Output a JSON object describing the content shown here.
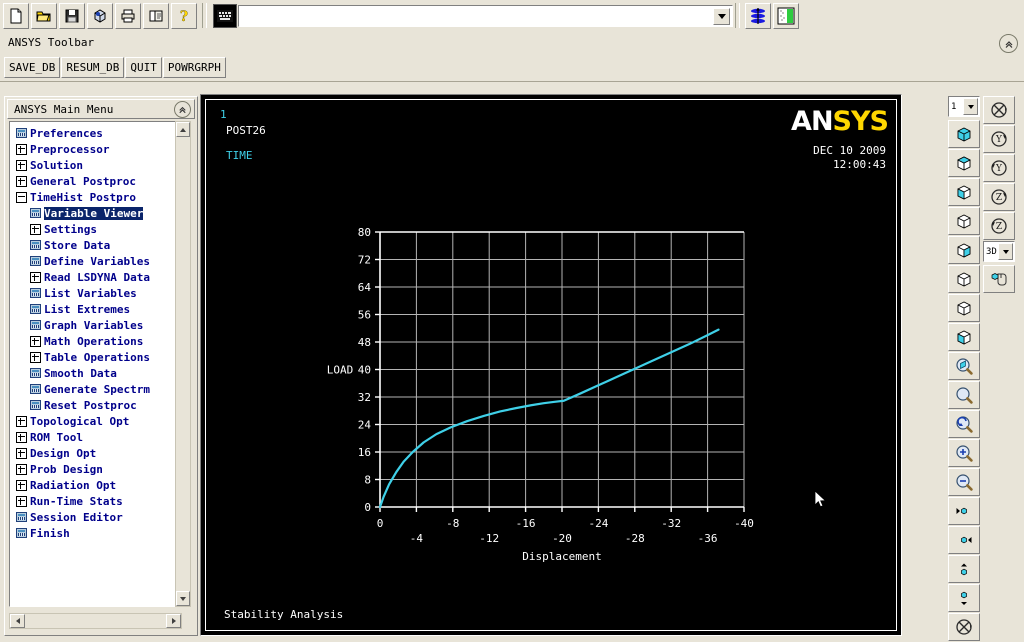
{
  "toolbar_top": {
    "buttons": [
      {
        "name": "new-file-icon",
        "label": "New"
      },
      {
        "name": "open-folder-icon",
        "label": "Open"
      },
      {
        "name": "save-disk-icon",
        "label": "Save"
      },
      {
        "name": "cube-report-icon",
        "label": "Report"
      },
      {
        "name": "printer-icon",
        "label": "Print"
      },
      {
        "name": "pages-icon",
        "label": "Pages"
      },
      {
        "name": "help-question-icon",
        "label": "Help"
      }
    ],
    "right_buttons": [
      {
        "name": "pan-zoom-rotate-icon",
        "label": "Pan-Zoom-Rotate"
      },
      {
        "name": "contour-plot-icon",
        "label": "Contour Plot"
      }
    ],
    "command_input": {
      "value": "",
      "placeholder": ""
    }
  },
  "ansys_toolbar": {
    "title": "ANSYS Toolbar",
    "collapse_icon": "chevron-up-circle-icon",
    "buttons": [
      "SAVE_DB",
      "RESUM_DB",
      "QUIT",
      "POWRGRPH"
    ]
  },
  "sidebar": {
    "title": "ANSYS Main Menu",
    "collapse_icon": "chevron-up-circle-icon",
    "items": [
      {
        "label": "Preferences",
        "indent": 0,
        "marker": "sheet",
        "selected": false
      },
      {
        "label": "Preprocessor",
        "indent": 0,
        "marker": "plus",
        "selected": false
      },
      {
        "label": "Solution",
        "indent": 0,
        "marker": "plus",
        "selected": false
      },
      {
        "label": "General Postproc",
        "indent": 0,
        "marker": "plus",
        "selected": false
      },
      {
        "label": "TimeHist Postpro",
        "indent": 0,
        "marker": "minus",
        "selected": false
      },
      {
        "label": "Variable Viewer",
        "indent": 1,
        "marker": "sheet",
        "selected": true
      },
      {
        "label": "Settings",
        "indent": 1,
        "marker": "plus",
        "selected": false
      },
      {
        "label": "Store Data",
        "indent": 1,
        "marker": "sheet",
        "selected": false
      },
      {
        "label": "Define Variables",
        "indent": 1,
        "marker": "sheet",
        "selected": false
      },
      {
        "label": "Read LSDYNA Data",
        "indent": 1,
        "marker": "plus",
        "selected": false
      },
      {
        "label": "List Variables",
        "indent": 1,
        "marker": "sheet",
        "selected": false
      },
      {
        "label": "List Extremes",
        "indent": 1,
        "marker": "sheet",
        "selected": false
      },
      {
        "label": "Graph Variables",
        "indent": 1,
        "marker": "sheet",
        "selected": false
      },
      {
        "label": "Math Operations",
        "indent": 1,
        "marker": "plus",
        "selected": false
      },
      {
        "label": "Table Operations",
        "indent": 1,
        "marker": "plus",
        "selected": false
      },
      {
        "label": "Smooth Data",
        "indent": 1,
        "marker": "sheet",
        "selected": false
      },
      {
        "label": "Generate Spectrm",
        "indent": 1,
        "marker": "sheet",
        "selected": false
      },
      {
        "label": "Reset Postproc",
        "indent": 1,
        "marker": "sheet",
        "selected": false
      },
      {
        "label": "Topological Opt",
        "indent": 0,
        "marker": "plus",
        "selected": false
      },
      {
        "label": "ROM Tool",
        "indent": 0,
        "marker": "plus",
        "selected": false
      },
      {
        "label": "Design Opt",
        "indent": 0,
        "marker": "plus",
        "selected": false
      },
      {
        "label": "Prob Design",
        "indent": 0,
        "marker": "plus",
        "selected": false
      },
      {
        "label": "Radiation Opt",
        "indent": 0,
        "marker": "plus",
        "selected": false
      },
      {
        "label": "Run-Time Stats",
        "indent": 0,
        "marker": "plus",
        "selected": false
      },
      {
        "label": "Session Editor",
        "indent": 0,
        "marker": "sheet",
        "selected": false
      },
      {
        "label": "Finish",
        "indent": 0,
        "marker": "sheet",
        "selected": false
      }
    ]
  },
  "graphics": {
    "window_number": "1",
    "post_processor": "POST26",
    "variable": "TIME",
    "logo_white": "AN",
    "logo_yellow": "SYS",
    "date": "DEC 10 2009",
    "time": "12:00:43",
    "caption": "Stability Analysis",
    "colors": {
      "background": "#000000",
      "curve": "#3fd0e8",
      "grid": "#b4b4b4",
      "axis": "#ffffff",
      "logo_accent": "#ffd700"
    }
  },
  "chart_data": {
    "type": "line",
    "title": "Stability Analysis",
    "subtitle": "POST26",
    "xlabel": "Displacement",
    "ylabel": "LOAD",
    "xlim": [
      0,
      -40
    ],
    "ylim": [
      0,
      80
    ],
    "xticks": [
      0,
      -4,
      -8,
      -12,
      -16,
      -20,
      -24,
      -28,
      -32,
      -36,
      -40
    ],
    "yticks": [
      0,
      8,
      16,
      24,
      32,
      40,
      48,
      56,
      64,
      72,
      80
    ],
    "grid": true,
    "legend": false,
    "series": [
      {
        "name": "LOAD vs Displacement",
        "color": "#3fd0e8",
        "x": [
          0,
          -0.4,
          -1.0,
          -1.8,
          -2.6,
          -3.6,
          -4.8,
          -6.2,
          -7.8,
          -9.6,
          -11.4,
          -13.2,
          -15.0,
          -16.6,
          -18.0,
          -19.2,
          -20.2,
          -22.0,
          -24.0,
          -26.0,
          -28.0,
          -30.0,
          -32.0,
          -34.0,
          -36.0,
          -37.2
        ],
        "y": [
          0,
          3.0,
          6.6,
          10.2,
          13.2,
          16.0,
          18.8,
          21.2,
          23.2,
          25.0,
          26.5,
          27.8,
          28.8,
          29.6,
          30.2,
          30.6,
          30.9,
          33.0,
          35.4,
          37.8,
          40.2,
          42.6,
          45.0,
          47.4,
          50.0,
          51.6
        ]
      }
    ]
  },
  "right_toolbar": {
    "view_select": {
      "value": "1",
      "name": "window-number-select"
    },
    "mode_select": {
      "value": "3D",
      "name": "dynamic-mode-select"
    },
    "column_a": [
      {
        "name": "isometric-view-icon",
        "label": "Isometric View"
      },
      {
        "name": "oblique-view-icon",
        "label": "Oblique View"
      },
      {
        "name": "front-view-icon",
        "label": "Front View"
      },
      {
        "name": "top-view-icon",
        "label": "Top View"
      },
      {
        "name": "left-view-icon",
        "label": "Left View"
      },
      {
        "name": "right-view-icon",
        "label": "Right View"
      },
      {
        "name": "bottom-view-icon",
        "label": "Bottom View"
      },
      {
        "name": "back-view-icon",
        "label": "Back View"
      },
      {
        "name": "zoom-box-icon",
        "label": "Box Zoom"
      },
      {
        "name": "zoom-window-icon",
        "label": "Window Zoom"
      },
      {
        "name": "zoom-back-icon",
        "label": "Previous Zoom"
      },
      {
        "name": "zoom-in-icon",
        "label": "Zoom In"
      },
      {
        "name": "zoom-out-icon",
        "label": "Zoom Out"
      },
      {
        "name": "pan-left-icon",
        "label": "Pan Left"
      },
      {
        "name": "pan-right-icon",
        "label": "Pan Right"
      },
      {
        "name": "pan-up-icon",
        "label": "Pan Up"
      },
      {
        "name": "pan-down-icon",
        "label": "Pan Down"
      },
      {
        "name": "fit-view-icon",
        "label": "Fit View"
      }
    ],
    "column_b": [
      {
        "name": "rotate-reset-icon",
        "label": "Reset Rotation"
      },
      {
        "name": "rotate-y-up-icon",
        "label": "Rotate +Y"
      },
      {
        "name": "rotate-y-down-icon",
        "label": "Rotate -Y"
      },
      {
        "name": "rotate-z-up-icon",
        "label": "Rotate +Z"
      },
      {
        "name": "rotate-z-down-icon",
        "label": "Rotate -Z"
      },
      {
        "name": "mouse-dynamic-icon",
        "label": "Dynamic Mode"
      }
    ]
  }
}
